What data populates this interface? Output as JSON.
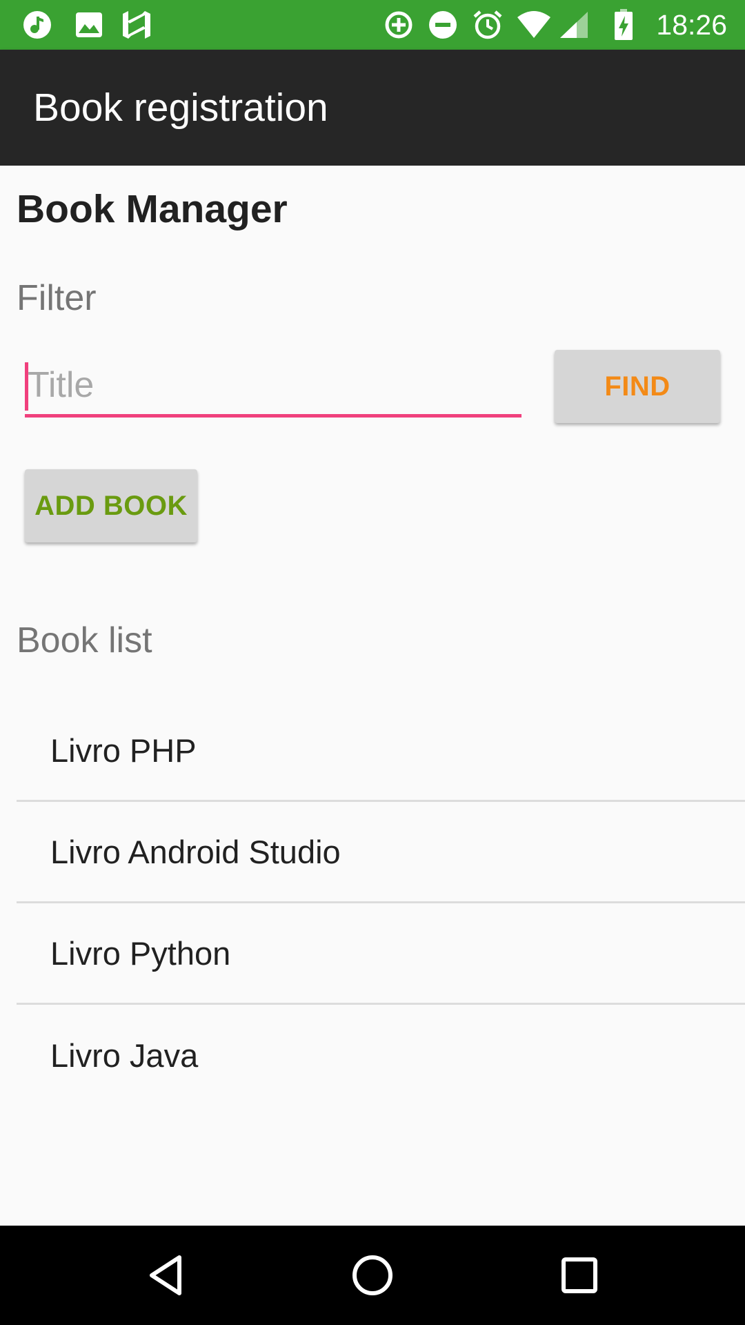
{
  "status_bar": {
    "time": "18:26",
    "left_icons": [
      "music-note-icon",
      "image-icon",
      "n-logo-icon"
    ],
    "right_icons": [
      "data-saver-icon",
      "do-not-disturb-icon",
      "alarm-icon",
      "wifi-icon",
      "cell-signal-icon",
      "battery-charging-icon"
    ],
    "background_color": "#3aa232"
  },
  "app_bar": {
    "title": "Book registration",
    "background_color": "#262626"
  },
  "main": {
    "heading": "Book Manager",
    "filter_label": "Filter",
    "title_input": {
      "placeholder": "Title",
      "value": ""
    },
    "find_button_label": "FIND",
    "add_book_button_label": "ADD BOOK",
    "book_list_label": "Book list",
    "books": [
      {
        "title": "Livro PHP"
      },
      {
        "title": "Livro Android Studio"
      },
      {
        "title": "Livro Python"
      },
      {
        "title": "Livro Java"
      }
    ]
  },
  "colors": {
    "accent": "#f0407d",
    "find_text": "#f38a17",
    "add_book_text": "#6a9b10"
  },
  "nav_bar": {
    "buttons": [
      "back-icon",
      "home-icon",
      "recents-icon"
    ]
  }
}
